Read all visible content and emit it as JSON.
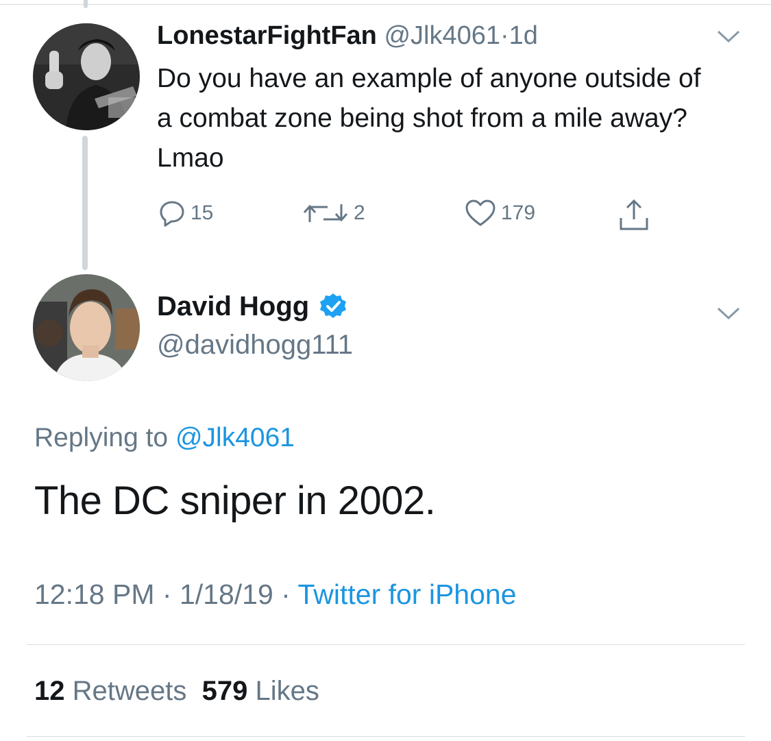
{
  "reply_tweet": {
    "display_name": "LonestarFightFan",
    "handle": "@Jlk4061",
    "separator": "·",
    "time_ago": "1d",
    "text": "Do you have an example of anyone outside of a combat zone being shot from a mile away? Lmao",
    "actions": {
      "replies": "15",
      "retweets": "2",
      "likes": "179"
    },
    "avatar_icon": "profile-photo"
  },
  "main_tweet": {
    "display_name": "David Hogg",
    "verified_icon": "verified-badge-icon",
    "handle": "@davidhogg111",
    "replying_prefix": "Replying to",
    "replying_to": "@Jlk4061",
    "text": "The DC sniper in 2002.",
    "time": "12:18 PM",
    "date": "1/18/19",
    "dot": "·",
    "source": "Twitter for iPhone",
    "retweet_count": "12",
    "retweet_label": "Retweets",
    "like_count": "579",
    "like_label": "Likes"
  },
  "colors": {
    "link": "#1b95e0",
    "muted": "#657786",
    "text": "#14171a",
    "verified": "#1da1f2"
  }
}
